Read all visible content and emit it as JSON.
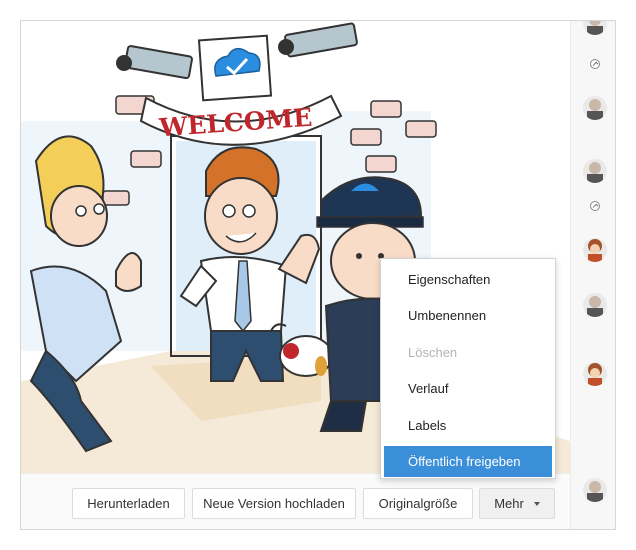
{
  "illustration": {
    "banner_text": "WELCOME",
    "accent": "#2a8de0"
  },
  "toolbar": {
    "download_label": "Herunterladen",
    "upload_version_label": "Neue Version hochladen",
    "original_size_label": "Originalgröße",
    "more_label": "Mehr"
  },
  "menu": {
    "items": [
      {
        "label": "Eigenschaften",
        "state": "normal"
      },
      {
        "label": "Umbenennen",
        "state": "normal"
      },
      {
        "label": "Löschen",
        "state": "disabled"
      },
      {
        "label": "Verlauf",
        "state": "normal"
      },
      {
        "label": "Labels",
        "state": "normal"
      },
      {
        "label": "Öffentlich freigeben",
        "state": "highlighted"
      }
    ],
    "highlight_color": "#3a8fd8"
  },
  "activity_rail": {
    "entries": [
      "avatar-man",
      "upload-icon",
      "avatar-man",
      "avatar-man",
      "upload-icon",
      "avatar-woman",
      "avatar-man",
      "avatar-woman",
      "avatar-man"
    ]
  }
}
